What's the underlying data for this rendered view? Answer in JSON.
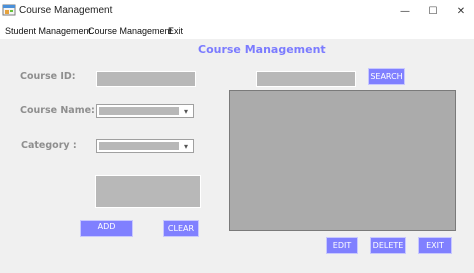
{
  "window": {
    "title": "Course Management",
    "controls": {
      "minimize": "—",
      "maximize": "☐",
      "close": "✕"
    }
  },
  "menu": {
    "items": [
      {
        "label": "Student Management"
      },
      {
        "label": "Course Management"
      },
      {
        "label": "Exit"
      }
    ]
  },
  "form": {
    "title": "Course Management",
    "labels": {
      "course_id": "Course ID:",
      "course_name": "Course Name:",
      "category": "Category :"
    },
    "inputs": {
      "course_id_value": "",
      "search_value": "",
      "description_value": "",
      "course_name_selected": "",
      "category_selected": ""
    },
    "buttons": {
      "search": "SEARCH",
      "add": "ADD",
      "clear": "CLEAR",
      "edit": "EDIT",
      "delete": "DELETE",
      "exit": "EXIT"
    }
  },
  "colors": {
    "accent": "#8080ff",
    "title_accent": "#7b7bff",
    "label": "#8e8e8e",
    "field": "#b8b8b8",
    "grid": "#ababab",
    "background": "#f0f0f0"
  },
  "icons": {
    "app": "app-window-icon",
    "combo": "chevron-down-icon"
  }
}
